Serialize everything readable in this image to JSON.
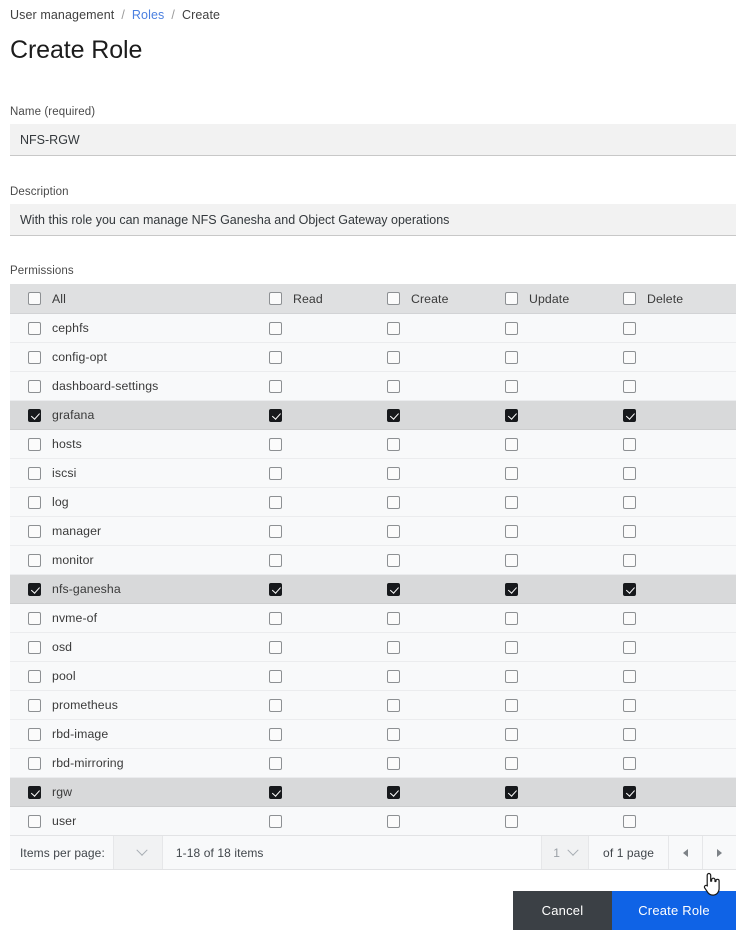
{
  "breadcrumb": {
    "items": [
      {
        "label": "User management",
        "link": false
      },
      {
        "label": "Roles",
        "link": true
      },
      {
        "label": "Create",
        "link": false
      }
    ],
    "separator": "/"
  },
  "page_title": "Create Role",
  "form": {
    "name": {
      "label": "Name (required)",
      "value": "NFS-RGW",
      "placeholder": ""
    },
    "description": {
      "label": "Description",
      "value": "With this role you can manage NFS Ganesha and Object Gateway operations",
      "placeholder": ""
    },
    "permissions_label": "Permissions"
  },
  "table": {
    "headers": {
      "scope": "All",
      "read": "Read",
      "create": "Create",
      "update": "Update",
      "delete": "Delete"
    },
    "header_checked": {
      "scope": false,
      "read": false,
      "create": false,
      "update": false,
      "delete": false
    },
    "rows": [
      {
        "name": "cephfs",
        "all": false,
        "read": false,
        "create": false,
        "update": false,
        "delete": false
      },
      {
        "name": "config-opt",
        "all": false,
        "read": false,
        "create": false,
        "update": false,
        "delete": false
      },
      {
        "name": "dashboard-settings",
        "all": false,
        "read": false,
        "create": false,
        "update": false,
        "delete": false
      },
      {
        "name": "grafana",
        "all": true,
        "read": true,
        "create": true,
        "update": true,
        "delete": true
      },
      {
        "name": "hosts",
        "all": false,
        "read": false,
        "create": false,
        "update": false,
        "delete": false
      },
      {
        "name": "iscsi",
        "all": false,
        "read": false,
        "create": false,
        "update": false,
        "delete": false
      },
      {
        "name": "log",
        "all": false,
        "read": false,
        "create": false,
        "update": false,
        "delete": false
      },
      {
        "name": "manager",
        "all": false,
        "read": false,
        "create": false,
        "update": false,
        "delete": false
      },
      {
        "name": "monitor",
        "all": false,
        "read": false,
        "create": false,
        "update": false,
        "delete": false
      },
      {
        "name": "nfs-ganesha",
        "all": true,
        "read": true,
        "create": true,
        "update": true,
        "delete": true
      },
      {
        "name": "nvme-of",
        "all": false,
        "read": false,
        "create": false,
        "update": false,
        "delete": false
      },
      {
        "name": "osd",
        "all": false,
        "read": false,
        "create": false,
        "update": false,
        "delete": false
      },
      {
        "name": "pool",
        "all": false,
        "read": false,
        "create": false,
        "update": false,
        "delete": false
      },
      {
        "name": "prometheus",
        "all": false,
        "read": false,
        "create": false,
        "update": false,
        "delete": false
      },
      {
        "name": "rbd-image",
        "all": false,
        "read": false,
        "create": false,
        "update": false,
        "delete": false
      },
      {
        "name": "rbd-mirroring",
        "all": false,
        "read": false,
        "create": false,
        "update": false,
        "delete": false
      },
      {
        "name": "rgw",
        "all": true,
        "read": true,
        "create": true,
        "update": true,
        "delete": true
      },
      {
        "name": "user",
        "all": false,
        "read": false,
        "create": false,
        "update": false,
        "delete": false
      }
    ]
  },
  "pagination": {
    "items_per_page_label": "Items per page:",
    "items_per_page_value": "",
    "range_text": "1-18 of 18 items",
    "current_page": "1",
    "of_pages_text": "of 1 page",
    "prev_icon": "triangle-left-icon",
    "next_icon": "triangle-right-icon"
  },
  "actions": {
    "cancel_label": "Cancel",
    "submit_label": "Create Role"
  },
  "colors": {
    "link": "#4a7fe0",
    "submit": "#0f63e6",
    "cancel": "#3b4045",
    "checkbox_checked": "#17191c",
    "header_row": "#dfe0e1",
    "row_checked": "#d8d9da",
    "row_default": "#f8f9fa"
  },
  "cursor": {
    "icon": "pointing-hand-cursor"
  }
}
